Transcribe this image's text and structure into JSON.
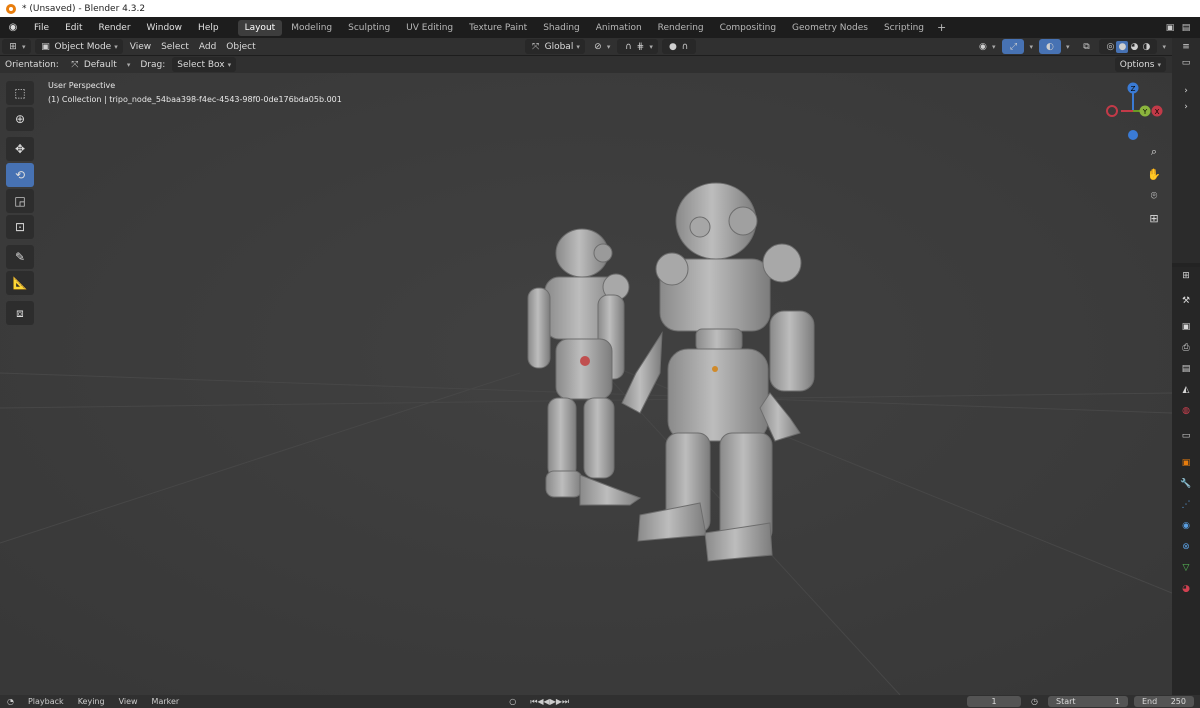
{
  "window": {
    "title": "* (Unsaved) - Blender 4.3.2"
  },
  "menu": [
    "File",
    "Edit",
    "Render",
    "Window",
    "Help"
  ],
  "workspaces": [
    "Layout",
    "Modeling",
    "Sculpting",
    "UV Editing",
    "Texture Paint",
    "Shading",
    "Animation",
    "Rendering",
    "Compositing",
    "Geometry Nodes",
    "Scripting"
  ],
  "active_workspace": "Layout",
  "header": {
    "mode": "Object Mode",
    "menus": [
      "View",
      "Select",
      "Add",
      "Object"
    ],
    "transform_orientation": "Global"
  },
  "tool_settings": {
    "orientation_label": "Orientation:",
    "orientation_value": "Default",
    "drag_label": "Drag:",
    "drag_value": "Select Box",
    "options_label": "Options"
  },
  "viewport": {
    "perspective": "User Perspective",
    "collection_info": "(1) Collection | tripo_node_54baa398-f4ec-4543-98f0-0de176bda05b.001",
    "background_color": "#3d3d3d"
  },
  "gizmo": {
    "z": "Z",
    "y": "Y",
    "x": "X"
  },
  "timeline": {
    "menus": [
      "Playback",
      "Keying",
      "View",
      "Marker"
    ],
    "current_frame": "1",
    "start_label": "Start",
    "start_value": "1",
    "end_label": "End",
    "end_value": "250"
  },
  "colors": {
    "accent": "#4772b3",
    "brand": "#e87d0d"
  }
}
